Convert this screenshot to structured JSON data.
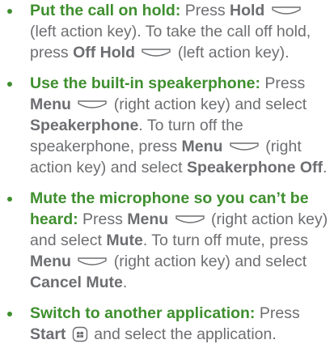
{
  "colors": {
    "lead_text": "#3f8f2f",
    "body_text": "#6d6e71",
    "bullet": "#3f8f2f",
    "icon_stroke": "#6d6e71"
  },
  "items": [
    {
      "lead": "Put the call on hold:",
      "t1": " Press ",
      "k1": "Hold",
      "t2": " (left action key). To take the call off hold, press ",
      "k2": "Off Hold",
      "t3": " (left action key)."
    },
    {
      "lead": "Use the built-in speakerphone:",
      "t1": " Press ",
      "k1": "Menu",
      "t2": " (right action key) and select ",
      "k2": "Speakerphone",
      "t3": ". To turn off the speakerphone, press ",
      "k3": "Menu",
      "t4": " (right action key) and select ",
      "k4": "Speakerphone Off",
      "t5": "."
    },
    {
      "lead": "Mute the microphone so you can’t be heard:",
      "t1": " Press ",
      "k1": "Menu",
      "t2": " (right action key) and select ",
      "k2": "Mute",
      "t3": ". To turn off mute, press ",
      "k3": "Menu",
      "t4": " (right action key) and select ",
      "k4": "Cancel Mute",
      "t5": "."
    },
    {
      "lead": "Switch to another application:",
      "t1": " Press ",
      "k1": "Start",
      "t2": " and select the application."
    }
  ],
  "icons": {
    "action_key": "action-key-icon",
    "start_key": "start-key-icon"
  }
}
